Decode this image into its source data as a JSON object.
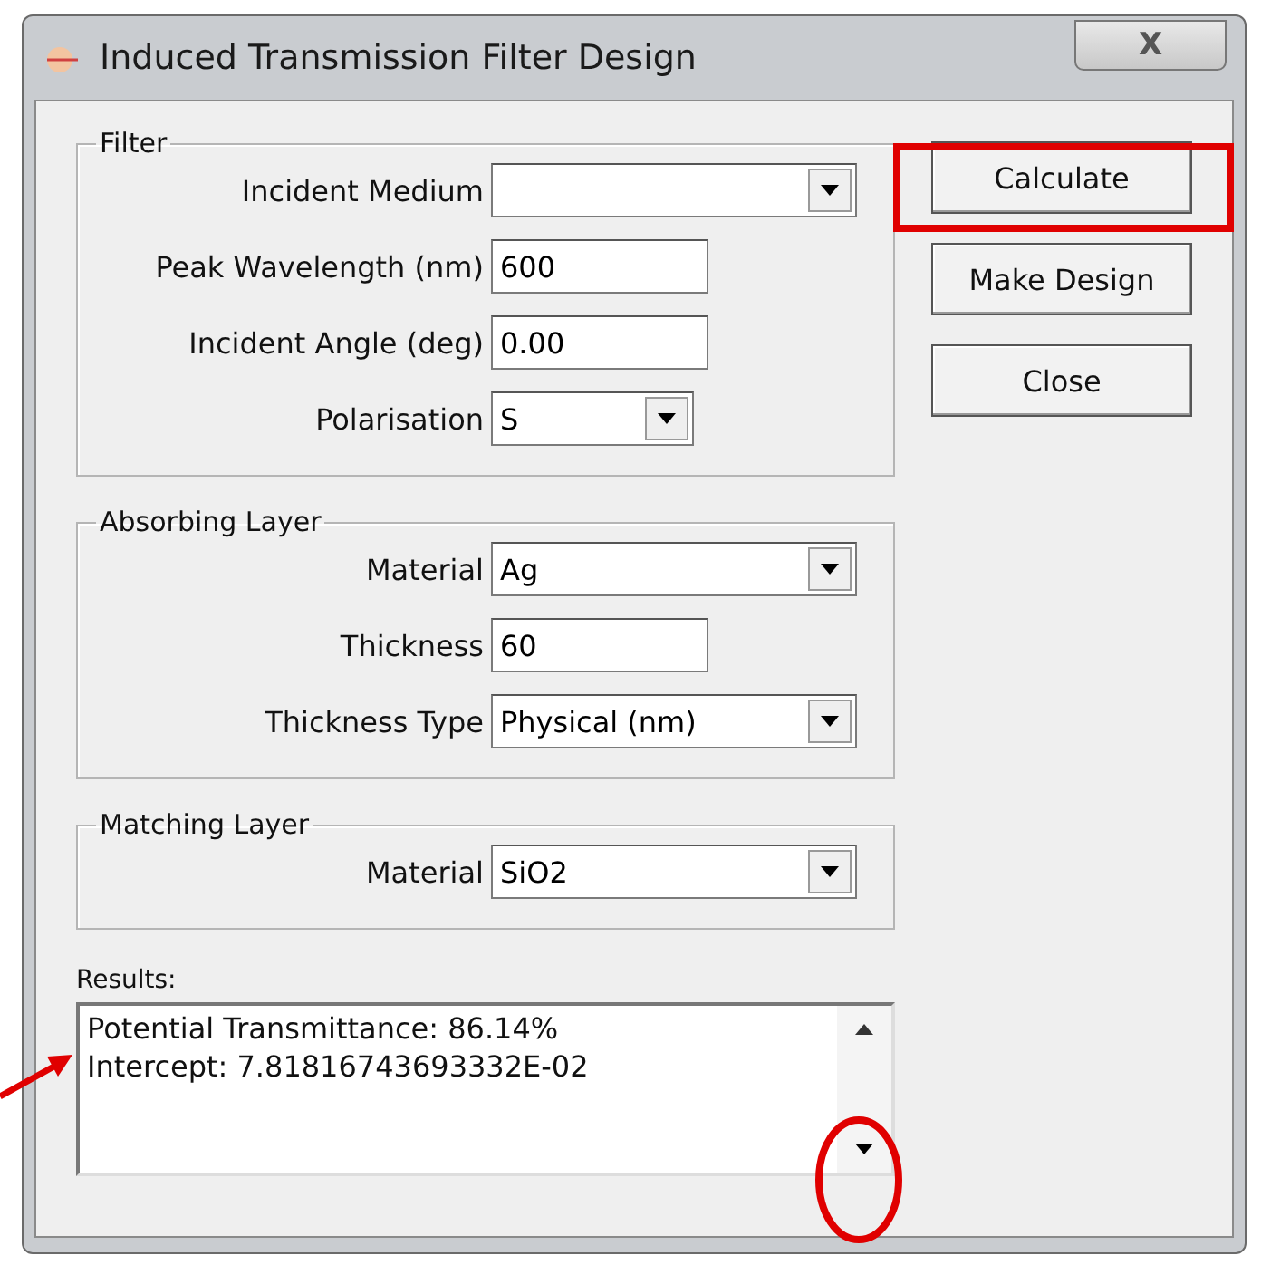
{
  "window": {
    "title": "Induced Transmission Filter Design",
    "close": "X"
  },
  "groups": [
    {
      "title": "Filter",
      "fields": [
        {
          "label": "Incident Medium",
          "kind": "dropdown"
        },
        {
          "label": "Peak Wavelength (nm)",
          "kind": "text",
          "value": "600"
        },
        {
          "label": "Incident Angle (deg)",
          "kind": "text",
          "value": "0.00"
        },
        {
          "label": "Polarisation",
          "kind": "short-dropdown",
          "value": "S"
        }
      ]
    },
    {
      "title": "Absorbing Layer",
      "fields": [
        {
          "label": "Material",
          "kind": "dropdown",
          "value": "Ag"
        },
        {
          "label": "Thickness",
          "kind": "text",
          "value": "60"
        },
        {
          "label": "Thickness Type",
          "kind": "dropdown",
          "value": "Physical (nm)"
        }
      ]
    },
    {
      "title": "Matching Layer",
      "fields": [
        {
          "label": "Material",
          "kind": "dropdown",
          "value": "SiO2"
        }
      ]
    }
  ],
  "buttons": [
    "Calculate",
    "Make Design",
    "Close"
  ],
  "results": {
    "label": "Results:",
    "lines": [
      "Potential Transmittance: 86.14%",
      "Intercept: 7.81816743693332E-02"
    ]
  }
}
